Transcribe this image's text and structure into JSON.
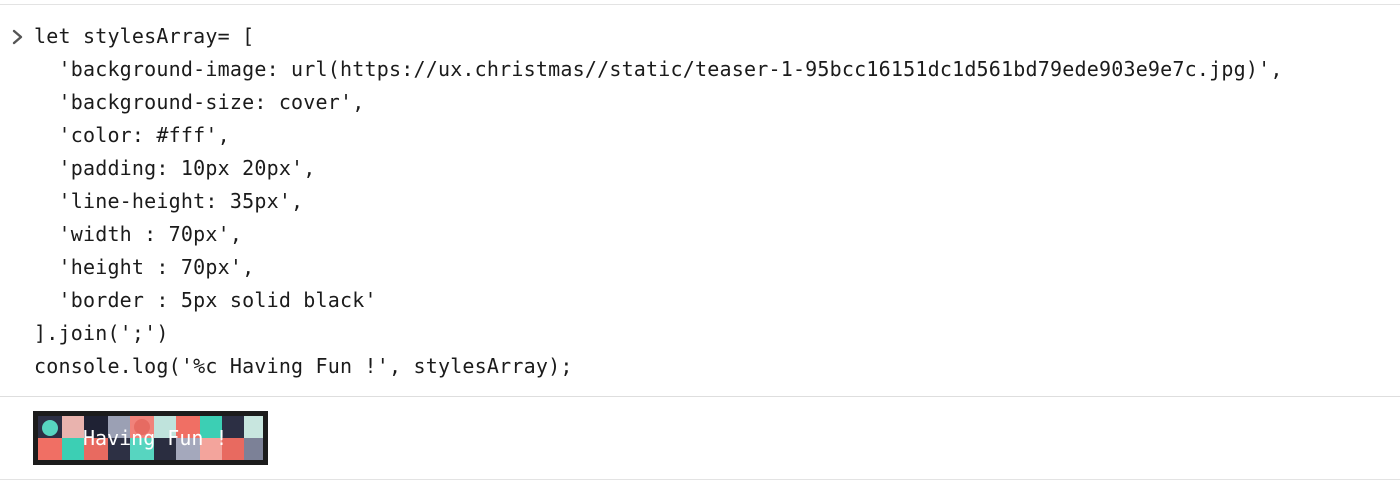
{
  "console": {
    "prompt_icon": "chevron-right-icon",
    "input_lines": [
      "let stylesArray= [",
      "  'background-image: url(https://ux.christmas//static/teaser-1-95bcc16151dc1d561bd79ede903e9e7c.jpg)',",
      "  'background-size: cover',",
      "  'color: #fff',",
      "  'padding: 10px 20px',",
      "  'line-height: 35px',",
      "  'width : 70px',",
      "  'height : 70px',",
      "  'border : 5px solid black'",
      "].join(';')",
      "console.log('%c Having Fun !', stylesArray);"
    ],
    "output_text": "Having Fun !"
  },
  "colors": {
    "code_text": "#1b1b1b",
    "prompt": "#555555",
    "divider": "#dedede",
    "log_text": "#ffffff",
    "log_border": "#1c1c1c"
  }
}
